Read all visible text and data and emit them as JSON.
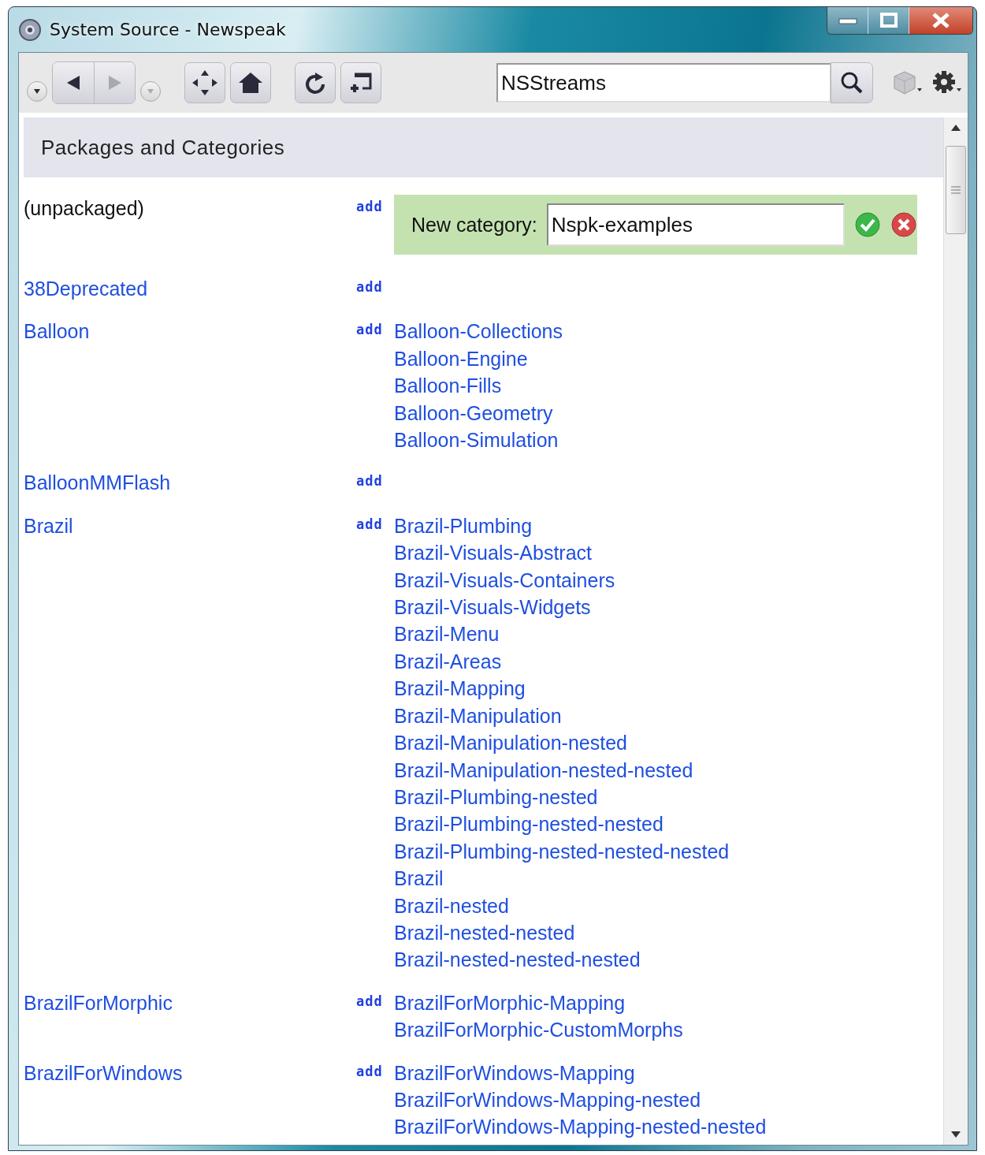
{
  "window": {
    "title": "System Source - Newspeak"
  },
  "toolbar": {
    "history_menu": {
      "disabled": false
    },
    "back": {
      "disabled": false
    },
    "forward": {
      "disabled": true
    },
    "forward_menu": {
      "disabled": true
    },
    "search": {
      "value": "NSStreams"
    }
  },
  "header": {
    "title": "Packages and Categories"
  },
  "packages": [
    {
      "name": "(unpackaged)",
      "kind": "plain",
      "add": "add",
      "new_category": {
        "label": "New category:",
        "value": "Nspk-examples"
      }
    },
    {
      "name": "38Deprecated",
      "kind": "link",
      "add": "add"
    },
    {
      "name": "Balloon",
      "kind": "link",
      "add": "add",
      "categories": [
        "Balloon-Collections",
        "Balloon-Engine",
        "Balloon-Fills",
        "Balloon-Geometry",
        "Balloon-Simulation"
      ]
    },
    {
      "name": "BalloonMMFlash",
      "kind": "link",
      "add": "add"
    },
    {
      "name": "Brazil",
      "kind": "link",
      "add": "add",
      "categories": [
        "Brazil-Plumbing",
        "Brazil-Visuals-Abstract",
        "Brazil-Visuals-Containers",
        "Brazil-Visuals-Widgets",
        "Brazil-Menu",
        "Brazil-Areas",
        "Brazil-Mapping",
        "Brazil-Manipulation",
        "Brazil-Manipulation-nested",
        "Brazil-Manipulation-nested-nested",
        "Brazil-Plumbing-nested",
        "Brazil-Plumbing-nested-nested",
        "Brazil-Plumbing-nested-nested-nested",
        "Brazil",
        "Brazil-nested",
        "Brazil-nested-nested",
        "Brazil-nested-nested-nested"
      ]
    },
    {
      "name": "BrazilForMorphic",
      "kind": "link",
      "add": "add",
      "categories": [
        "BrazilForMorphic-Mapping",
        "BrazilForMorphic-CustomMorphs"
      ]
    },
    {
      "name": "BrazilForWindows",
      "kind": "link",
      "add": "add",
      "categories": [
        "BrazilForWindows-Mapping",
        "BrazilForWindows-Mapping-nested",
        "BrazilForWindows-Mapping-nested-nested"
      ]
    }
  ]
}
